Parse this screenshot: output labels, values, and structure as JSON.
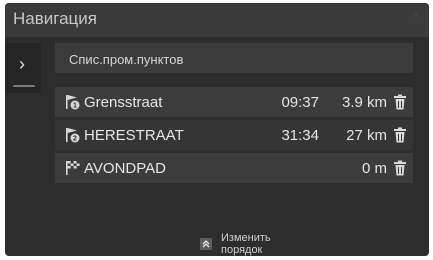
{
  "header": {
    "title": "Навигация",
    "status_icon": "signal-icon"
  },
  "sidebar": {
    "toggle_icon": "chevron-right-icon",
    "toggle_glyph": "›"
  },
  "list": {
    "header_label": "Спис.пром.пунктов",
    "items": [
      {
        "icon": "waypoint-1-flag-icon",
        "name": "Grensstraat",
        "time": "09:37",
        "distance": "3.9 km"
      },
      {
        "icon": "waypoint-2-flag-icon",
        "name": "HERESTRAAT",
        "time": "31:34",
        "distance": "27 km"
      },
      {
        "icon": "destination-flag-icon",
        "name": "AVONDPAD",
        "time": "",
        "distance": "0 m"
      }
    ]
  },
  "footer": {
    "reorder_label": "Изменить порядок",
    "reorder_icon": "double-chevron-up-icon"
  },
  "colors": {
    "background": "#2d2d2e",
    "header": "#3a3a3b",
    "row": "#3c3c3d",
    "text": "#e6e6e6"
  }
}
